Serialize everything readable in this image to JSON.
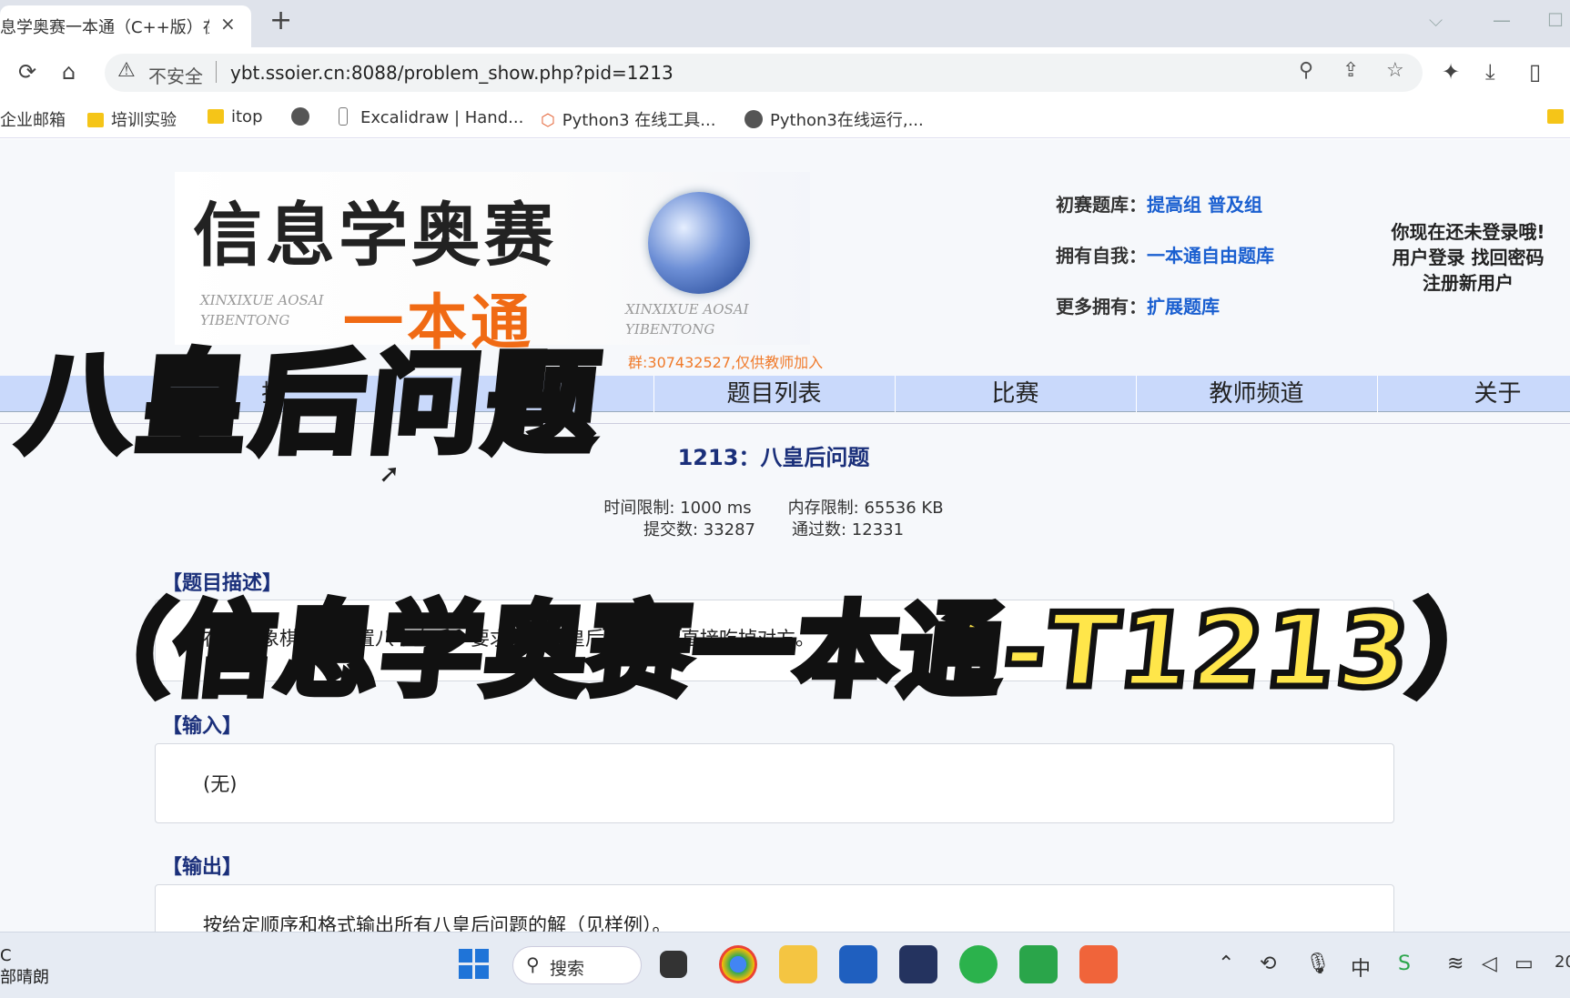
{
  "browser": {
    "tab_title": "息学奥赛一本通（C++版）在",
    "tab_close": "×",
    "new_tab": "+",
    "not_secure": "不安全",
    "url": "ybt.ssoier.cn:8088/problem_show.php?pid=1213",
    "bookmarks": [
      "企业邮箱",
      "培训实验",
      "itop",
      "Excalidraw | Hand...",
      "Python3 在线工具...",
      "Python3在线运行,..."
    ]
  },
  "site": {
    "logo_main": "信息学奥赛",
    "logo_sub": "一本通",
    "pinyin_left": [
      "XINXIXUE AOSAI",
      "YIBENTONG"
    ],
    "pinyin_right": [
      "XINXIXUE AOSAI",
      "YIBENTONG"
    ],
    "qq_group": "群:307432527,仅供教师加入",
    "links": [
      {
        "label": "初赛题库：",
        "value": "提高组 普及组"
      },
      {
        "label": "拥有自我：",
        "value": "一本通自由题库"
      },
      {
        "label": "更多拥有：",
        "value": "扩展题库"
      }
    ],
    "login_lines": [
      "你现在还未登录哦!",
      "用户登录  找回密码",
      "注册新用户"
    ]
  },
  "nav": [
    "排",
    "题目列表",
    "比赛",
    "教师频道",
    "关于"
  ],
  "problem": {
    "title": "1213：八皇后问题",
    "time_limit": "时间限制: 1000 ms",
    "memory_limit": "内存限制: 65536 KB",
    "submissions": "提交数: 33287",
    "accepted": "通过数: 12331",
    "desc_head": "【题目描述】",
    "desc_text": "在国际象棋盘上放置八个皇后，要求每两个皇后之间不能直接吃掉对方。",
    "input_head": "【输入】",
    "input_text": "(无)",
    "output_head": "【输出】",
    "output_text": "按给定顺序和格式输出所有八皇后问题的解（见样例）。"
  },
  "overlay": {
    "title": "八皇后问题",
    "subtitle": "（信息学奥赛一本通-T1213）"
  },
  "taskbar": {
    "weather_lines": [
      "C",
      "部晴朗"
    ],
    "search": "搜索",
    "clock": "20"
  }
}
